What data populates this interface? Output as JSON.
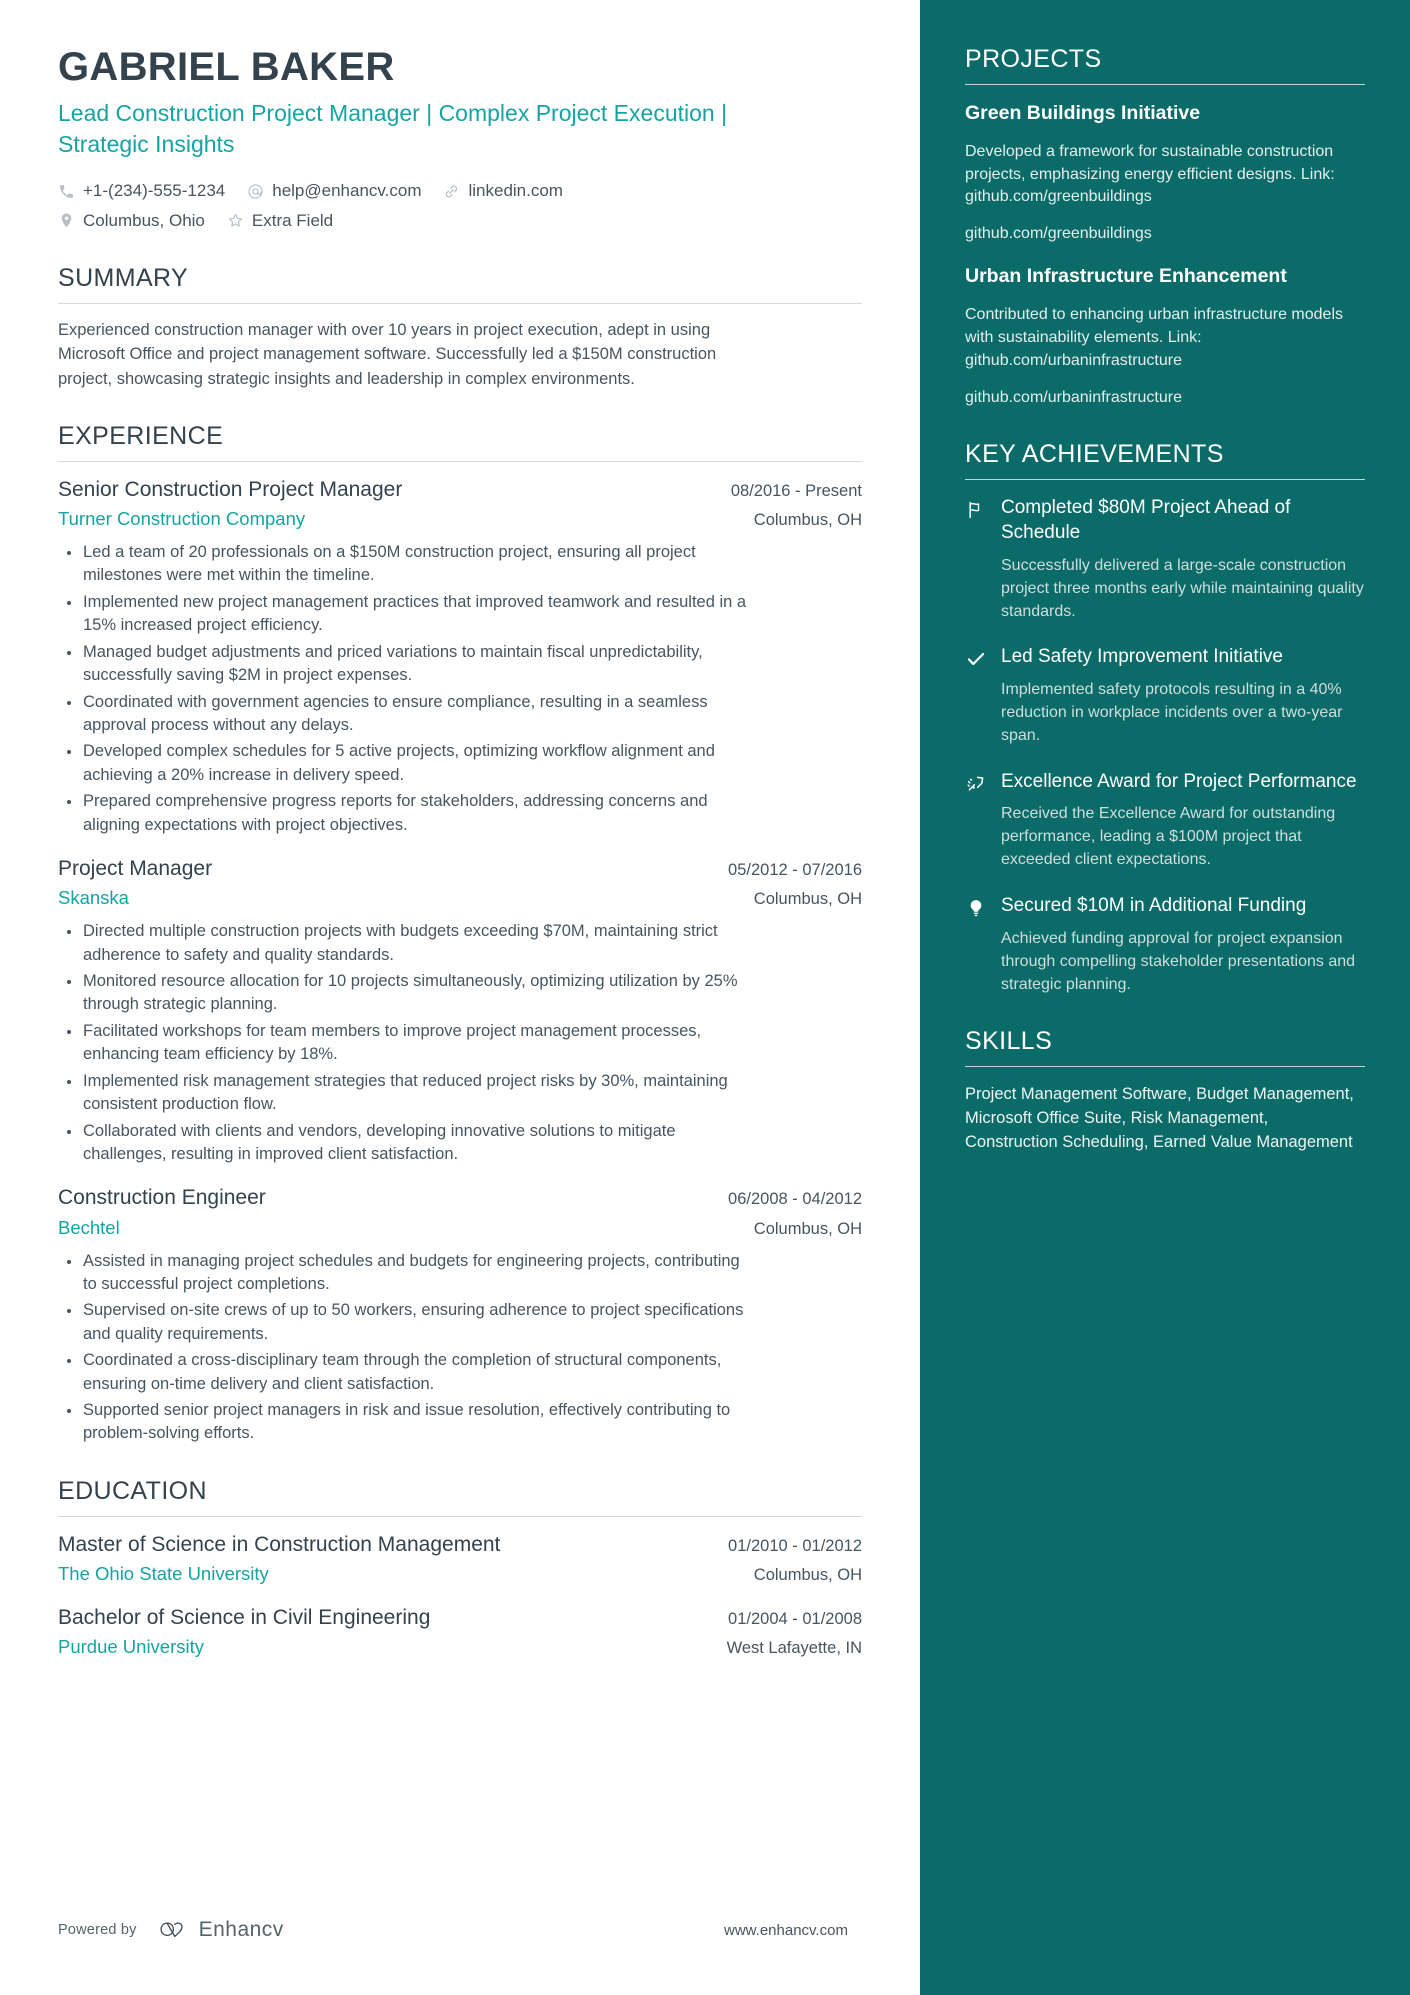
{
  "header": {
    "name": "GABRIEL BAKER",
    "headline": "Lead Construction Project Manager | Complex Project Execution | Strategic Insights",
    "contacts_row1": [
      {
        "icon": "phone-icon",
        "text": "+1-(234)-555-1234"
      },
      {
        "icon": "email-icon",
        "text": "help@enhancv.com"
      },
      {
        "icon": "link-icon",
        "text": "linkedin.com"
      }
    ],
    "contacts_row2": [
      {
        "icon": "location-pin-icon",
        "text": "Columbus, Ohio"
      },
      {
        "icon": "star-icon",
        "text": "Extra Field"
      }
    ]
  },
  "summary": {
    "title": "SUMMARY",
    "text": "Experienced construction manager with over 10 years in project execution, adept in using Microsoft Office and project management software. Successfully led a $150M construction project, showcasing strategic insights and leadership in complex environments."
  },
  "experience": {
    "title": "EXPERIENCE",
    "entries": [
      {
        "role": "Senior Construction Project Manager",
        "date": "08/2016 - Present",
        "company": "Turner Construction Company",
        "location": "Columbus, OH",
        "bullets": [
          "Led a team of 20 professionals on a $150M construction project, ensuring all project milestones were met within the timeline.",
          "Implemented new project management practices that improved teamwork and resulted in a 15% increased project efficiency.",
          "Managed budget adjustments and priced variations to maintain fiscal unpredictability, successfully saving $2M in project expenses.",
          "Coordinated with government agencies to ensure compliance, resulting in a seamless approval process without any delays.",
          "Developed complex schedules for 5 active projects, optimizing workflow alignment and achieving a 20% increase in delivery speed.",
          "Prepared comprehensive progress reports for stakeholders, addressing concerns and aligning expectations with project objectives."
        ]
      },
      {
        "role": "Project Manager",
        "date": "05/2012 - 07/2016",
        "company": "Skanska",
        "location": "Columbus, OH",
        "bullets": [
          "Directed multiple construction projects with budgets exceeding $70M, maintaining strict adherence to safety and quality standards.",
          "Monitored resource allocation for 10 projects simultaneously, optimizing utilization by 25% through strategic planning.",
          "Facilitated workshops for team members to improve project management processes, enhancing team efficiency by 18%.",
          "Implemented risk management strategies that reduced project risks by 30%, maintaining consistent production flow.",
          "Collaborated with clients and vendors, developing innovative solutions to mitigate challenges, resulting in improved client satisfaction."
        ]
      },
      {
        "role": "Construction Engineer",
        "date": "06/2008 - 04/2012",
        "company": "Bechtel",
        "location": "Columbus, OH",
        "bullets": [
          "Assisted in managing project schedules and budgets for engineering projects, contributing to successful project completions.",
          "Supervised on-site crews of up to 50 workers, ensuring adherence to project specifications and quality requirements.",
          "Coordinated a cross-disciplinary team through the completion of structural components, ensuring on-time delivery and client satisfaction.",
          "Supported senior project managers in risk and issue resolution, effectively contributing to problem-solving efforts."
        ]
      }
    ]
  },
  "education": {
    "title": "EDUCATION",
    "entries": [
      {
        "degree": "Master of Science in Construction Management",
        "date": "01/2010 - 01/2012",
        "school": "The Ohio State University",
        "location": "Columbus, OH"
      },
      {
        "degree": "Bachelor of Science in Civil Engineering",
        "date": "01/2004 - 01/2008",
        "school": "Purdue University",
        "location": "West Lafayette, IN"
      }
    ]
  },
  "footer": {
    "powered_by": "Powered by",
    "brand": "Enhancv",
    "url": "www.enhancv.com"
  },
  "projects": {
    "title": "PROJECTS",
    "items": [
      {
        "name": "Green Buildings Initiative",
        "description": "Developed a framework for sustainable construction projects, emphasizing energy efficient designs. Link: github.com/greenbuildings",
        "link": "github.com/greenbuildings"
      },
      {
        "name": "Urban Infrastructure Enhancement",
        "description": "Contributed to enhancing urban infrastructure models with sustainability elements. Link: github.com/urbaninfrastructure",
        "link": "github.com/urbaninfrastructure"
      }
    ]
  },
  "achievements": {
    "title": "KEY ACHIEVEMENTS",
    "items": [
      {
        "icon": "flag-icon",
        "title": "Completed $80M Project Ahead of Schedule",
        "description": "Successfully delivered a large-scale construction project three months early while maintaining quality standards."
      },
      {
        "icon": "check-icon",
        "title": "Led Safety Improvement Initiative",
        "description": "Implemented safety protocols resulting in a 40% reduction in workplace incidents over a two-year span."
      },
      {
        "icon": "rocket-icon",
        "title": "Excellence Award for Project Performance",
        "description": "Received the Excellence Award for outstanding performance, leading a $100M project that exceeded client expectations."
      },
      {
        "icon": "lightbulb-icon",
        "title": "Secured $10M in Additional Funding",
        "description": "Achieved funding approval for project expansion through compelling stakeholder presentations and strategic planning."
      }
    ]
  },
  "skills": {
    "title": "SKILLS",
    "text": "Project Management Software, Budget Management, Microsoft Office Suite, Risk Management, Construction Scheduling, Earned Value Management"
  },
  "colors": {
    "accent_teal": "#16a3a3",
    "sidebar_bg": "#0a6b68",
    "heading_dark": "#33424c",
    "body_text": "#46555f"
  }
}
